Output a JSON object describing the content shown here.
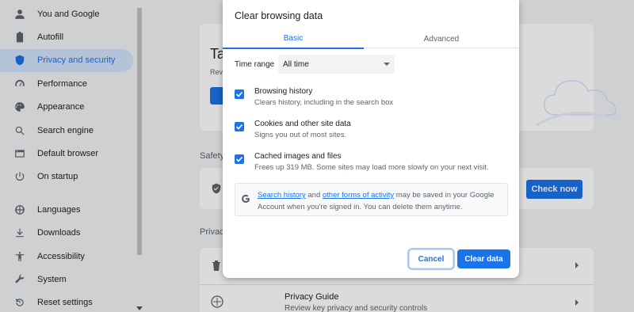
{
  "sidebar": {
    "items": [
      {
        "label": "You and Google",
        "icon": "person-icon",
        "active": false
      },
      {
        "label": "Autofill",
        "icon": "clipboard-icon",
        "active": false
      },
      {
        "label": "Privacy and security",
        "icon": "shield-icon",
        "active": true
      },
      {
        "label": "Performance",
        "icon": "speedometer-icon",
        "active": false
      },
      {
        "label": "Appearance",
        "icon": "palette-icon",
        "active": false
      },
      {
        "label": "Search engine",
        "icon": "search-icon",
        "active": false
      },
      {
        "label": "Default browser",
        "icon": "browser-icon",
        "active": false
      },
      {
        "label": "On startup",
        "icon": "power-icon",
        "active": false
      },
      {
        "label": "Languages",
        "icon": "globe-icon",
        "active": false
      },
      {
        "label": "Downloads",
        "icon": "download-icon",
        "active": false
      },
      {
        "label": "Accessibility",
        "icon": "accessibility-icon",
        "active": false
      },
      {
        "label": "System",
        "icon": "wrench-icon",
        "active": false
      },
      {
        "label": "Reset settings",
        "icon": "reset-icon",
        "active": false
      }
    ]
  },
  "main": {
    "card1_title": "Ta",
    "card1_sub": "Rev",
    "safety_label": "Safety",
    "check_now": "Check now",
    "privacy_label": "Privac",
    "privacy_guide_title": "Privacy Guide",
    "privacy_guide_sub": "Review key privacy and security controls"
  },
  "dialog": {
    "title": "Clear browsing data",
    "tabs": {
      "basic": "Basic",
      "advanced": "Advanced"
    },
    "time_range": {
      "label": "Time range",
      "value": "All time"
    },
    "options": [
      {
        "label": "Browsing history",
        "desc": "Clears history, including in the search box",
        "checked": true
      },
      {
        "label": "Cookies and other site data",
        "desc": "Signs you out of most sites.",
        "checked": true
      },
      {
        "label": "Cached images and files",
        "desc": "Frees up 319 MB. Some sites may load more slowly on your next visit.",
        "checked": true
      }
    ],
    "notice": {
      "link1": "Search history",
      "mid1": " and ",
      "link2": "other forms of activity",
      "rest": " may be saved in your Google Account when you're signed in. You can delete them anytime."
    },
    "buttons": {
      "cancel": "Cancel",
      "clear": "Clear data"
    }
  },
  "colors": {
    "accent": "#1a73e8",
    "active_bg": "#d3e3fd"
  }
}
